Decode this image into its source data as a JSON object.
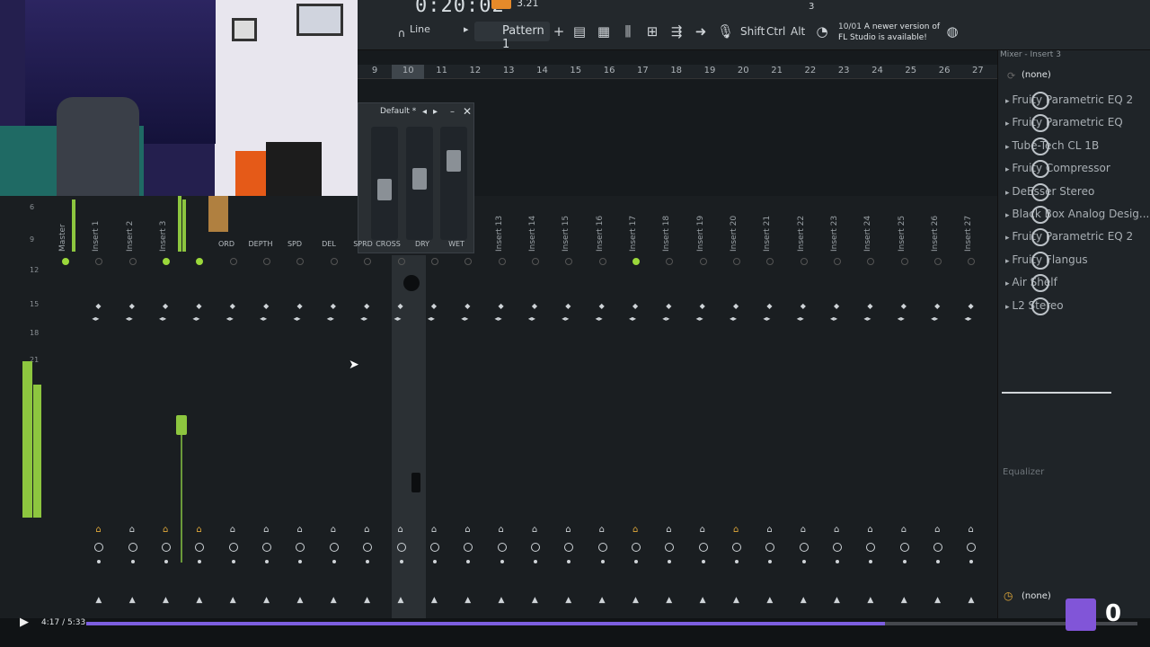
{
  "toolbar": {
    "time": "0:20:02",
    "cpu": "3.21",
    "line_mode": "Line",
    "pattern": "Pattern 1",
    "shift": "Shift",
    "ctrl": "Ctrl",
    "alt": "Alt",
    "update_date": "10/01",
    "update_line1": "A newer version of",
    "update_line2": "FL Studio is available!",
    "pattern_number": "3"
  },
  "ruler": [
    "9",
    "10",
    "11",
    "12",
    "13",
    "14",
    "15",
    "16",
    "17",
    "18",
    "19",
    "20",
    "21",
    "22",
    "23",
    "24",
    "25",
    "26",
    "27"
  ],
  "fx_window": {
    "title": "Default *",
    "labels": [
      "ORD",
      "DEPTH",
      "SPD",
      "DEL",
      "SPRD",
      "CROSS",
      "DRY",
      "WET"
    ]
  },
  "mixer": {
    "strips": [
      "Master",
      "Insert 1",
      "Insert 2",
      "Insert 3",
      "Insert 13",
      "Insert 14",
      "Insert 15",
      "Insert 16",
      "Insert 17",
      "Insert 18",
      "Insert 19",
      "Insert 20",
      "Insert 21",
      "Insert 22",
      "Insert 23",
      "Insert 24",
      "Insert 25",
      "Insert 26",
      "Insert 27"
    ],
    "db_marks": [
      "6",
      "9",
      "12",
      "15",
      "18",
      "21"
    ]
  },
  "panel": {
    "title": "Mixer - Insert 3",
    "input": "(none)",
    "slots": [
      "Fruity Parametric EQ 2",
      "Fruity Parametric EQ",
      "Tube-Tech CL 1B",
      "Fruity Compressor",
      "DeEsser Stereo",
      "Black Box Analog Desig...",
      "Fruity Parametric EQ 2",
      "Fruity Flangus",
      "Air Shelf",
      "L2 Stereo"
    ],
    "eq_label": "Equalizer",
    "output": "(none)",
    "output2": "(none)"
  },
  "player": {
    "time": "4:17 / 5:33",
    "progress": 0.76,
    "viewer_count": "0"
  },
  "colors": {
    "accent": "#8dc63f",
    "progress": "#7d5fe0",
    "twitch": "#8155d8"
  }
}
